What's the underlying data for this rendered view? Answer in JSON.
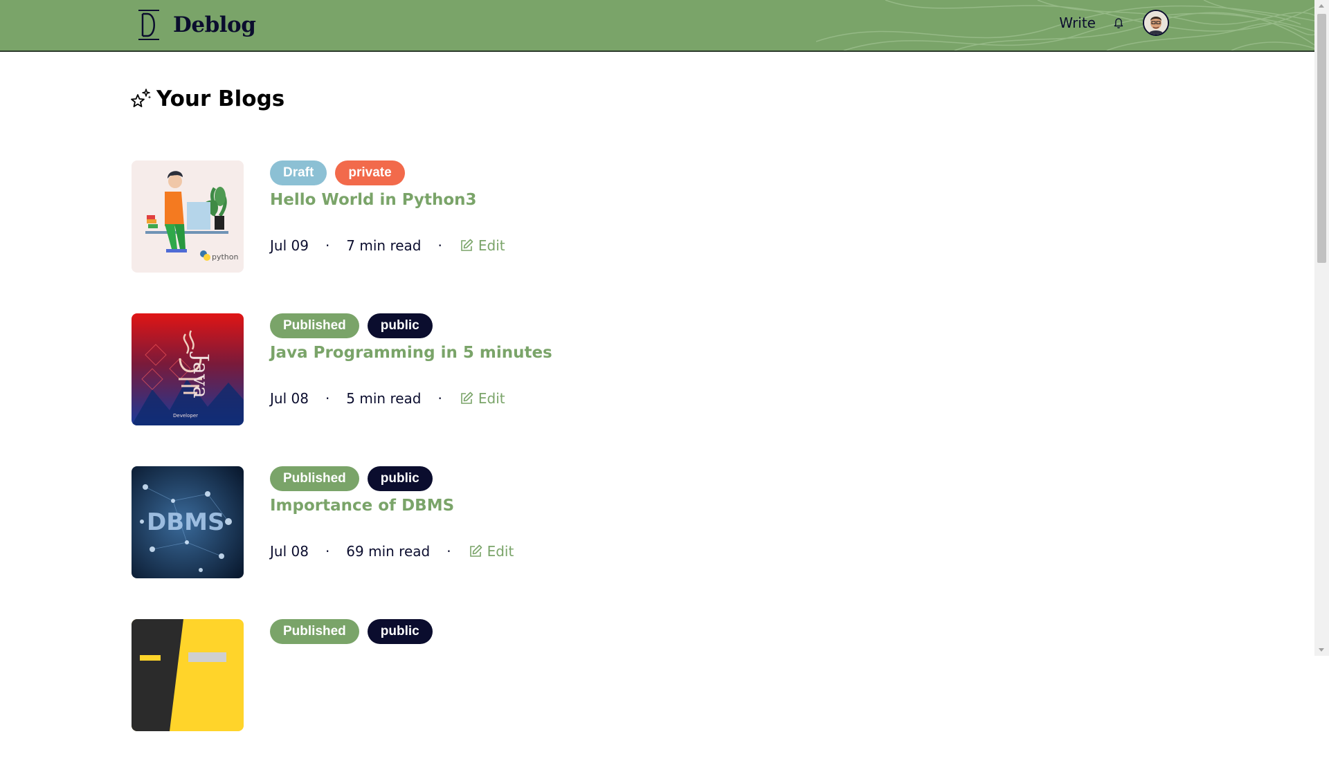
{
  "header": {
    "brand": "Deblog",
    "brand_mark": "D",
    "write_label": "Write",
    "bell_icon": "bell-icon",
    "avatar_icon": "user-avatar",
    "background_color": "#7aa469"
  },
  "page": {
    "title": "Your Blogs",
    "title_icon": "sparkle-icon"
  },
  "colors": {
    "accent": "#7aa469",
    "draft": "#8cc0d4",
    "private": "#f26a4b",
    "published": "#7aa469",
    "public": "#0b0d2e"
  },
  "blogs": [
    {
      "status": "Draft",
      "visibility": "private",
      "title": "Hello World in Python3",
      "date": "Jul 09",
      "read_time": "7 min read",
      "separator": "·",
      "edit_label": "Edit",
      "thumbnail": "python-illustration"
    },
    {
      "status": "Published",
      "visibility": "public",
      "title": "Java Programming in 5 minutes",
      "date": "Jul 08",
      "read_time": "5 min read",
      "separator": "·",
      "edit_label": "Edit",
      "thumbnail": "java-logo-image"
    },
    {
      "status": "Published",
      "visibility": "public",
      "title": "Importance of DBMS",
      "date": "Jul 08",
      "read_time": "69 min read",
      "separator": "·",
      "edit_label": "Edit",
      "thumbnail": "dbms-network-image"
    },
    {
      "status": "Published",
      "visibility": "public",
      "title": "",
      "date": "",
      "read_time": "",
      "separator": "",
      "edit_label": "",
      "thumbnail": "yellow-dark-image"
    }
  ]
}
